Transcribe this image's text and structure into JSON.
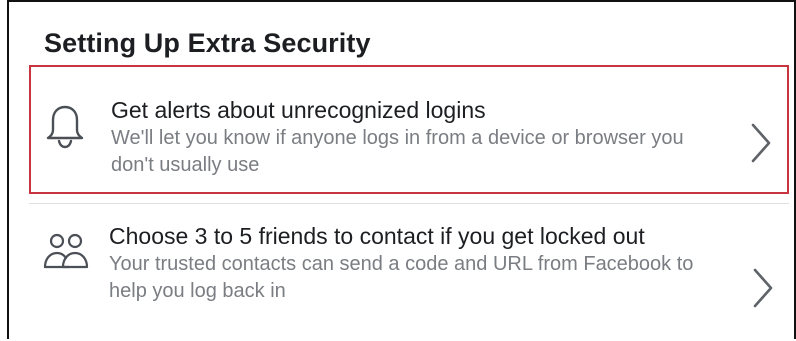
{
  "section": {
    "title": "Setting Up Extra Security"
  },
  "items": [
    {
      "icon": "bell-icon",
      "title": "Get alerts about unrecognized logins",
      "description": "We'll let you know if anyone logs in from a device or browser you don't usually use",
      "highlighted": true,
      "highlight_color": "#c8343f"
    },
    {
      "icon": "friends-icon",
      "title": "Choose 3 to 5 friends to contact if you get locked out",
      "description": "Your trusted contacts can send a code and URL from Facebook to help you log back in",
      "highlighted": false
    }
  ],
  "colors": {
    "title_text": "#1c1e21",
    "secondary_text": "#7a7d82",
    "divider": "#dddfe2"
  }
}
